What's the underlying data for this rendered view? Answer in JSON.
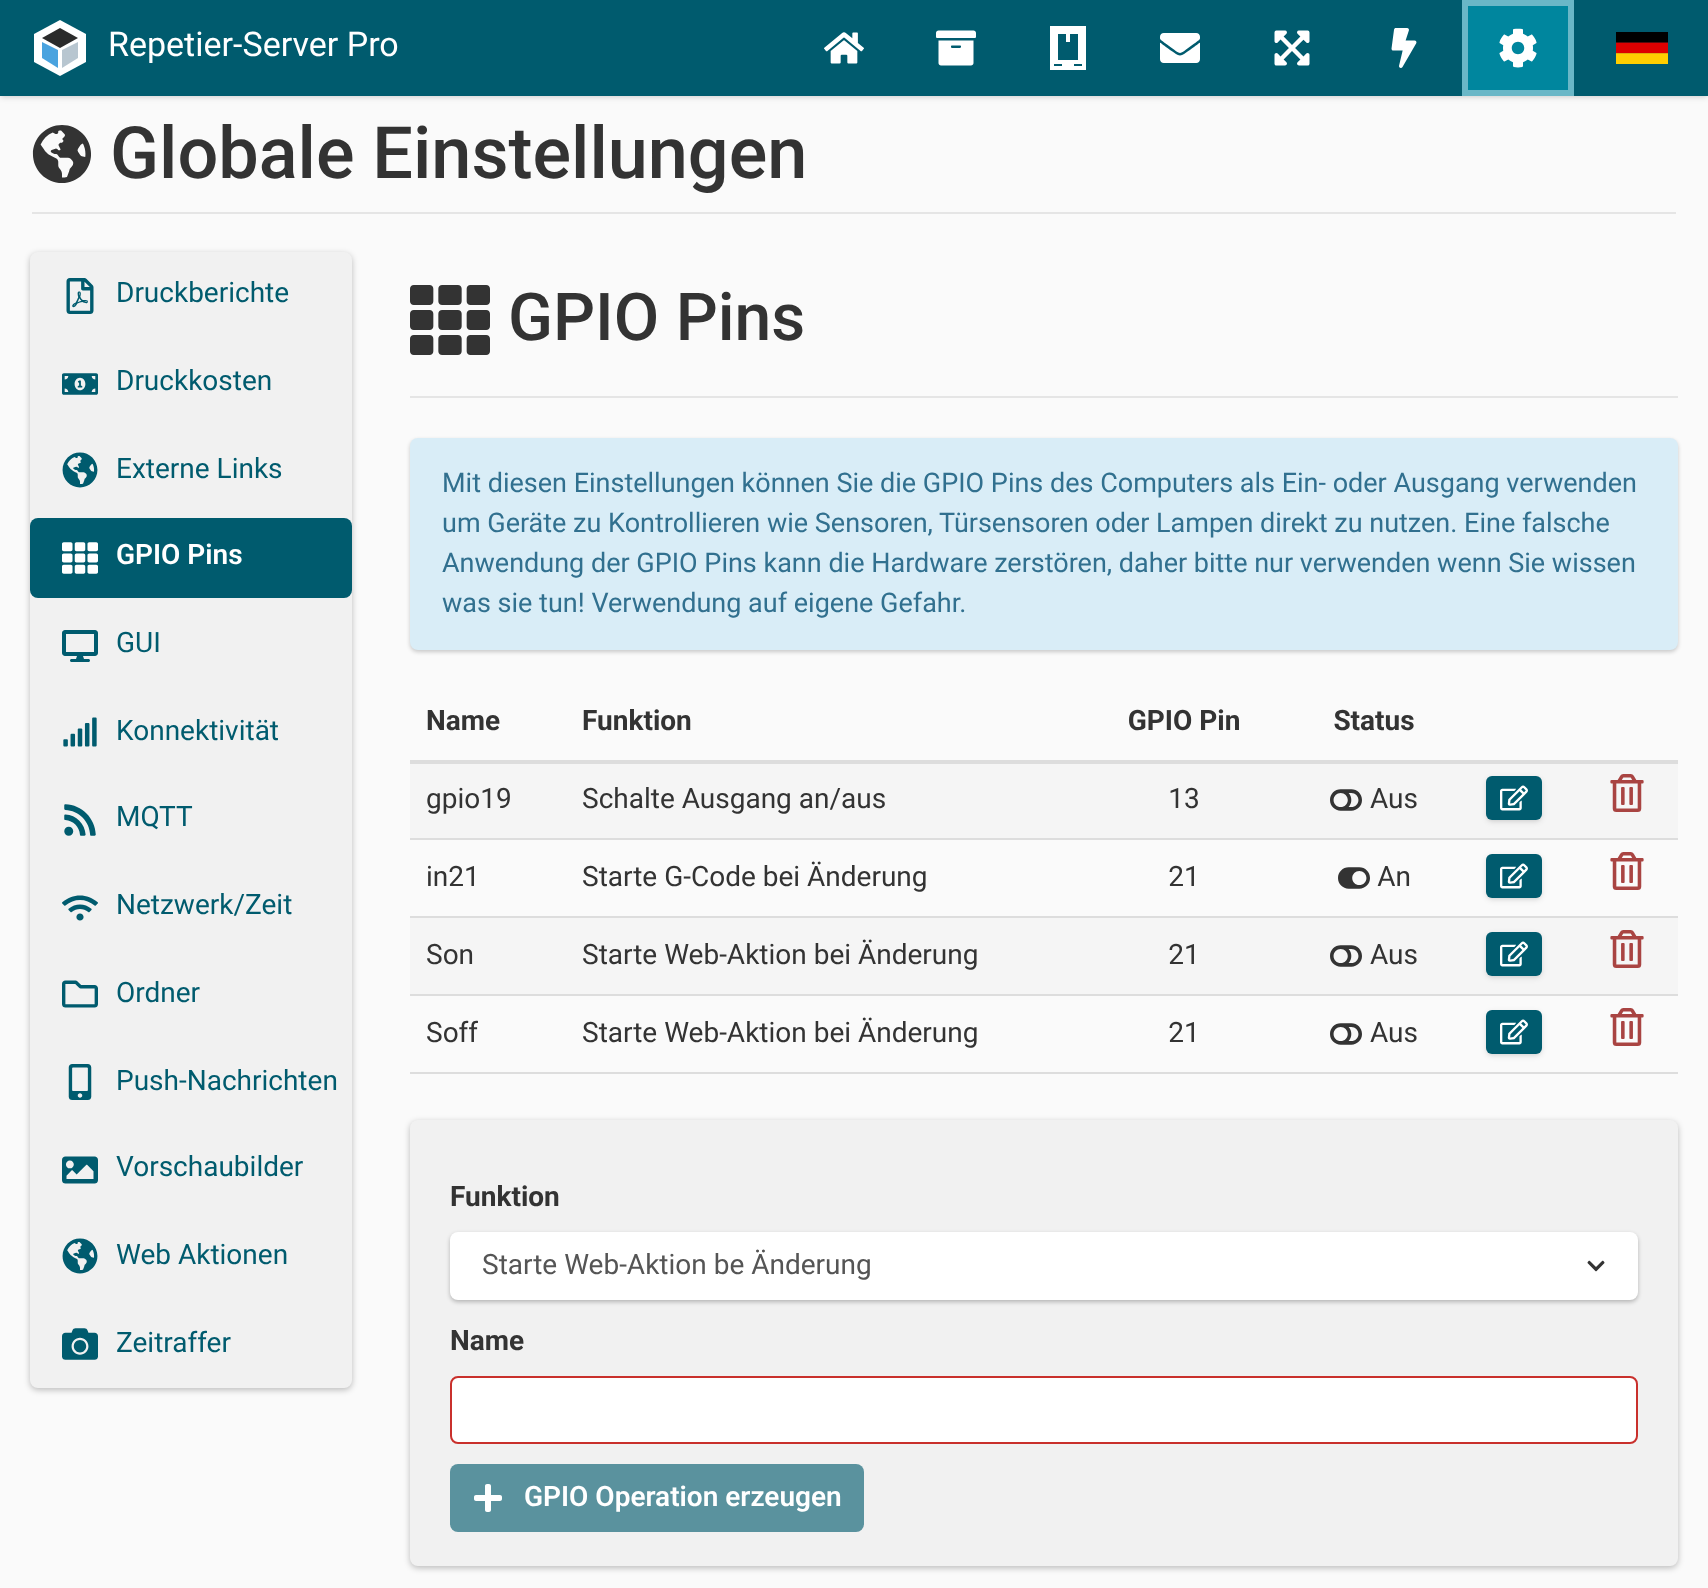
{
  "app": {
    "title": "Repetier-Server Pro"
  },
  "nav": [
    {
      "selected": false
    },
    {
      "selected": false
    },
    {
      "selected": false
    },
    {
      "selected": false
    },
    {
      "selected": false
    },
    {
      "selected": false
    },
    {
      "selected": true
    },
    {
      "selected": false
    }
  ],
  "page_title": "Globale Einstellungen",
  "sidebar": {
    "items": [
      {
        "label": "Druckberichte",
        "selected": false
      },
      {
        "label": "Druckkosten",
        "selected": false
      },
      {
        "label": "Externe Links",
        "selected": false
      },
      {
        "label": "GPIO Pins",
        "selected": true
      },
      {
        "label": "GUI",
        "selected": false
      },
      {
        "label": "Konnektivität",
        "selected": false
      },
      {
        "label": "MQTT",
        "selected": false
      },
      {
        "label": "Netzwerk/Zeit",
        "selected": false
      },
      {
        "label": "Ordner",
        "selected": false
      },
      {
        "label": "Push-Nachrichten",
        "selected": false
      },
      {
        "label": "Vorschaubilder",
        "selected": false
      },
      {
        "label": "Web Aktionen",
        "selected": false
      },
      {
        "label": "Zeitraffer",
        "selected": false
      }
    ]
  },
  "section_title": "GPIO Pins",
  "info": "Mit diesen Einstellungen können Sie die GPIO Pins des Computers als Ein- oder Ausgang verwenden um Geräte zu Kontrollieren wie Sensoren, Türsensoren oder Lampen direkt zu nutzen. Eine falsche Anwendung der GPIO Pins kann die Hardware zerstören, daher bitte nur verwenden wenn Sie wissen was sie tun! Verwendung auf eigene Gefahr.",
  "table": {
    "columns": [
      "Name",
      "Funktion",
      "GPIO Pin",
      "Status"
    ],
    "rows": [
      {
        "name": "gpio19",
        "function": "Schalte Ausgang an/aus",
        "pin": "13",
        "on": false,
        "status": "Aus"
      },
      {
        "name": "in21",
        "function": "Starte G-Code bei Änderung",
        "pin": "21",
        "on": true,
        "status": "An"
      },
      {
        "name": "Son",
        "function": "Starte Web-Aktion bei Änderung",
        "pin": "21",
        "on": false,
        "status": "Aus"
      },
      {
        "name": "Soff",
        "function": "Starte Web-Aktion bei Änderung",
        "pin": "21",
        "on": false,
        "status": "Aus"
      }
    ]
  },
  "form": {
    "function_label": "Funktion",
    "function_value": "Starte Web-Aktion be Änderung",
    "name_label": "Name",
    "name_invalid": true,
    "submit": "GPIO Operation erzeugen"
  }
}
